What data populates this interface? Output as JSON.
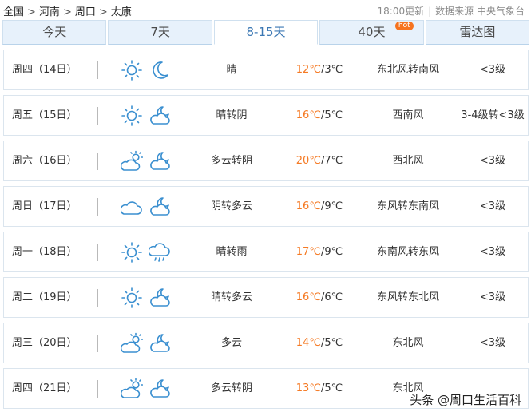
{
  "breadcrumb": [
    "全国",
    "河南",
    "周口",
    "太康"
  ],
  "update_time": "18:00更新",
  "source": "数据来源 中央气象台",
  "tabs": [
    {
      "label": "今天",
      "active": false
    },
    {
      "label": "7天",
      "active": false
    },
    {
      "label": "8-15天",
      "active": true
    },
    {
      "label": "40天",
      "active": false,
      "badge": "hot"
    },
    {
      "label": "雷达图",
      "active": false
    }
  ],
  "forecast": [
    {
      "day": "周四（14日）",
      "icon1": "sun-icon",
      "icon2": "moon-icon",
      "desc": "晴",
      "high": "12℃",
      "low": "/3℃",
      "wind": "东北风转南风",
      "level": "<3级"
    },
    {
      "day": "周五（15日）",
      "icon1": "sun-icon",
      "icon2": "moon-cloud-icon",
      "desc": "晴转阴",
      "high": "16℃",
      "low": "/5℃",
      "wind": "西南风",
      "level": "3-4级转<3级"
    },
    {
      "day": "周六（16日）",
      "icon1": "sun-cloud-icon",
      "icon2": "moon-cloud-icon",
      "desc": "多云转阴",
      "high": "20℃",
      "low": "/7℃",
      "wind": "西北风",
      "level": "<3级"
    },
    {
      "day": "周日（17日）",
      "icon1": "cloud-icon",
      "icon2": "moon-cloud-icon",
      "desc": "阴转多云",
      "high": "16℃",
      "low": "/9℃",
      "wind": "东风转东南风",
      "level": "<3级"
    },
    {
      "day": "周一（18日）",
      "icon1": "sun-icon",
      "icon2": "rain-icon",
      "desc": "晴转雨",
      "high": "17℃",
      "low": "/9℃",
      "wind": "东南风转东风",
      "level": "<3级"
    },
    {
      "day": "周二（19日）",
      "icon1": "sun-icon",
      "icon2": "moon-cloud-icon",
      "desc": "晴转多云",
      "high": "16℃",
      "low": "/6℃",
      "wind": "东风转东北风",
      "level": "<3级"
    },
    {
      "day": "周三（20日）",
      "icon1": "sun-cloud-icon",
      "icon2": "moon-cloud-icon",
      "desc": "多云",
      "high": "14℃",
      "low": "/5℃",
      "wind": "东北风",
      "level": "<3级"
    },
    {
      "day": "周四（21日）",
      "icon1": "sun-cloud-icon",
      "icon2": "moon-cloud-icon",
      "desc": "多云转阴",
      "high": "13℃",
      "low": "/5℃",
      "wind": "东北风",
      "level": ""
    }
  ],
  "watermark": "头条 @周口生活百科",
  "colors": {
    "tab_bg": "#e7f1fb",
    "active_tab_text": "#3c78b4",
    "temp_high": "#f57a24",
    "icon_blue": "#3a8fd0"
  }
}
